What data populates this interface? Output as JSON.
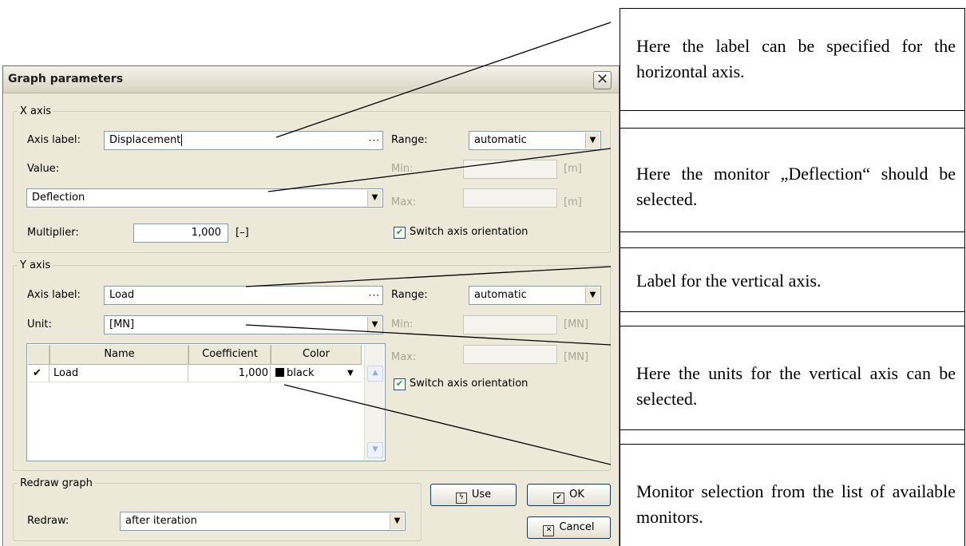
{
  "dialog": {
    "title": "Graph parameters",
    "close_glyph": "✕",
    "x_axis": {
      "group_label": "X axis",
      "axis_label_caption": "Axis label:",
      "axis_label_value": "Displacement",
      "browse_glyph": "···",
      "value_caption": "Value:",
      "value_selected": "Deflection",
      "multiplier_caption": "Multiplier:",
      "multiplier_value": "1,000",
      "multiplier_unit": "[–]",
      "range_caption": "Range:",
      "range_value": "automatic",
      "min_caption": "Min:",
      "min_unit": "[m]",
      "max_caption": "Max:",
      "max_unit": "[m]",
      "switch_orientation_label": "Switch axis orientation"
    },
    "y_axis": {
      "group_label": "Y axis",
      "axis_label_caption": "Axis label:",
      "axis_label_value": "Load",
      "browse_glyph": "···",
      "unit_caption": "Unit:",
      "unit_value": "[MN]",
      "range_caption": "Range:",
      "range_value": "automatic",
      "min_caption": "Min:",
      "min_unit": "[MN]",
      "max_caption": "Max:",
      "max_unit": "[MN]",
      "switch_orientation_label": "Switch axis orientation",
      "table": {
        "columns": [
          "Name",
          "Coefficient",
          "Color"
        ],
        "rows": [
          {
            "check": "✔",
            "name": "Load",
            "coefficient": "1,000",
            "color": "black",
            "swatch": "#000000"
          }
        ]
      }
    },
    "redraw": {
      "group_label": "Redraw graph",
      "caption": "Redraw:",
      "value": "after iteration"
    },
    "buttons": {
      "use": "Use",
      "ok": "OK",
      "cancel": "Cancel"
    },
    "dropdown_glyph": "▼"
  },
  "callouts": [
    "Here the label can be specified for the horizontal axis.",
    "Here the monitor „Deflection“ should be selected.",
    "Label for the vertical axis.",
    "Here the units for the vertical axis can be selected.",
    "Monitor selection from the list of available monitors."
  ]
}
